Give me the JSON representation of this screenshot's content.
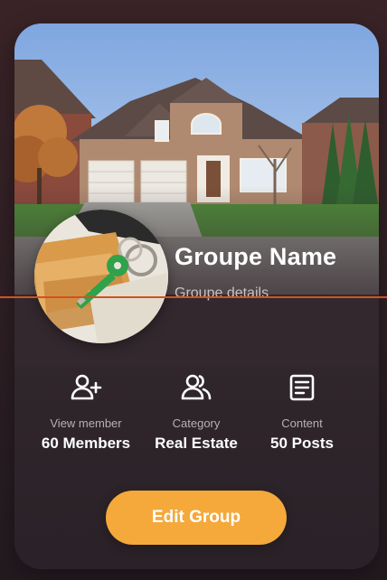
{
  "group": {
    "name": "Groupe Name",
    "details": "Groupe details"
  },
  "stats": [
    {
      "icon": "add-person-icon",
      "label": "View member",
      "value": "60 Members"
    },
    {
      "icon": "people-icon",
      "label": "Category",
      "value": "Real Estate"
    },
    {
      "icon": "document-icon",
      "label": "Content",
      "value": "50 Posts"
    }
  ],
  "actions": {
    "edit_label": "Edit Group"
  },
  "colors": {
    "accent": "#f4a93a",
    "card_background": "#33282e",
    "guide_line": "#d2521f"
  }
}
